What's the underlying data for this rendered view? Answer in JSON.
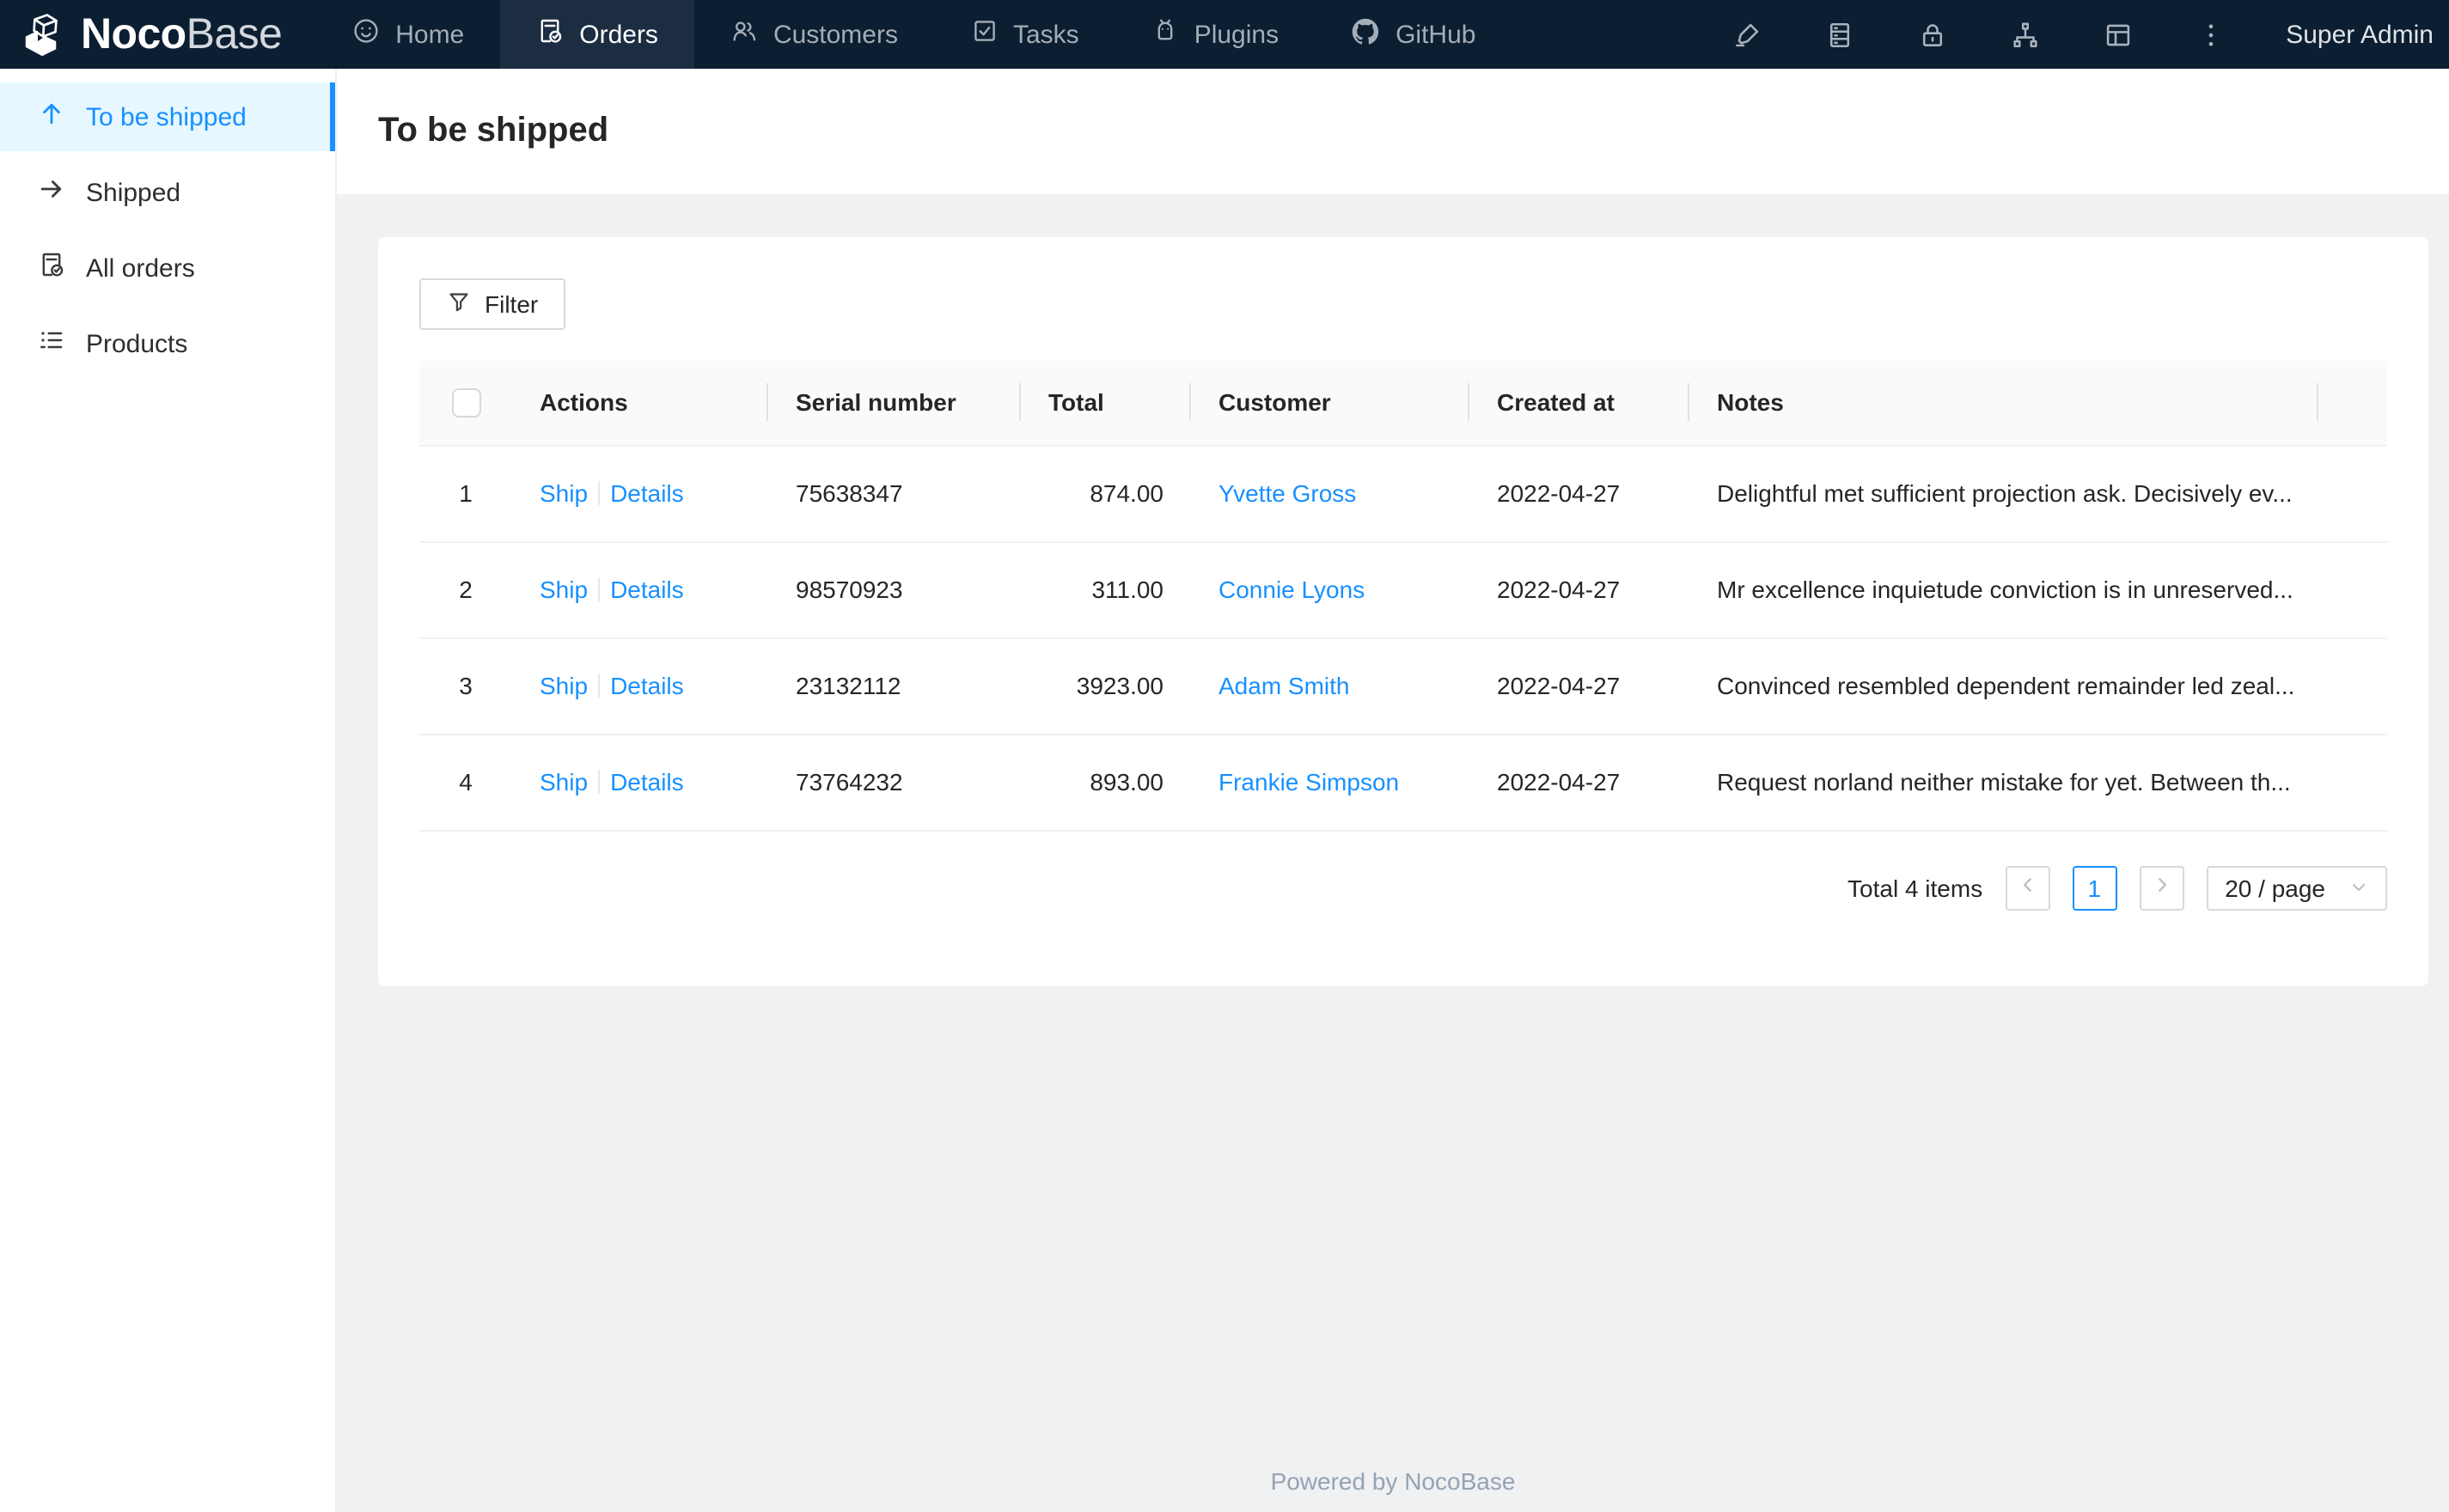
{
  "nav": {
    "logo": {
      "bold": "Noco",
      "light": "Base",
      "icon": "cube-logo-icon"
    },
    "items": [
      {
        "label": "Home",
        "icon": "smile-icon",
        "active": false
      },
      {
        "label": "Orders",
        "icon": "file-check-icon",
        "active": true
      },
      {
        "label": "Customers",
        "icon": "team-icon",
        "active": false
      },
      {
        "label": "Tasks",
        "icon": "check-square-icon",
        "active": false
      },
      {
        "label": "Plugins",
        "icon": "android-icon",
        "active": false
      },
      {
        "label": "GitHub",
        "icon": "github-icon",
        "active": false
      }
    ],
    "action_icons": [
      "highlight-icon",
      "database-icon",
      "lock-icon",
      "apartment-icon",
      "layout-icon",
      "more-vertical-icon"
    ],
    "user_name": "Super Admin"
  },
  "sidebar": {
    "items": [
      {
        "label": "To be shipped",
        "icon": "arrow-up-icon",
        "active": true
      },
      {
        "label": "Shipped",
        "icon": "arrow-right-icon",
        "active": false
      },
      {
        "label": "All orders",
        "icon": "file-check-icon",
        "active": false
      },
      {
        "label": "Products",
        "icon": "unordered-list-icon",
        "active": false
      }
    ]
  },
  "page": {
    "title": "To be shipped"
  },
  "toolbar": {
    "filter_label": "Filter",
    "filter_icon": "filter-funnel-icon"
  },
  "table": {
    "headers": [
      "Actions",
      "Serial number",
      "Total",
      "Customer",
      "Created at",
      "Notes"
    ],
    "rows": [
      {
        "index": "1",
        "actions": [
          "Ship",
          "Details"
        ],
        "serial": "75638347",
        "total": "874.00",
        "customer": "Yvette Gross",
        "created_at": "2022-04-27",
        "notes": "Delightful met sufficient projection ask. Decisively ev..."
      },
      {
        "index": "2",
        "actions": [
          "Ship",
          "Details"
        ],
        "serial": "98570923",
        "total": "311.00",
        "customer": "Connie Lyons",
        "created_at": "2022-04-27",
        "notes": "Mr excellence inquietude conviction is in unreserved..."
      },
      {
        "index": "3",
        "actions": [
          "Ship",
          "Details"
        ],
        "serial": "23132112",
        "total": "3923.00",
        "customer": "Adam Smith",
        "created_at": "2022-04-27",
        "notes": "Convinced resembled dependent remainder led zeal..."
      },
      {
        "index": "4",
        "actions": [
          "Ship",
          "Details"
        ],
        "serial": "73764232",
        "total": "893.00",
        "customer": "Frankie Simpson",
        "created_at": "2022-04-27",
        "notes": "Request norland neither mistake for yet. Between th..."
      }
    ]
  },
  "pagination": {
    "total_label": "Total 4 items",
    "current_page": "1",
    "page_size_label": "20 / page"
  },
  "footer": {
    "powered_by": "Powered by NocoBase"
  },
  "colors": {
    "accent": "#1890ff",
    "nav_bg": "#0c1e31",
    "nav_active_bg": "#1c2d42",
    "sidebar_active_bg": "#e6f7ff",
    "content_bg": "#f0f1f3",
    "table_header_bg": "#fafafa"
  }
}
